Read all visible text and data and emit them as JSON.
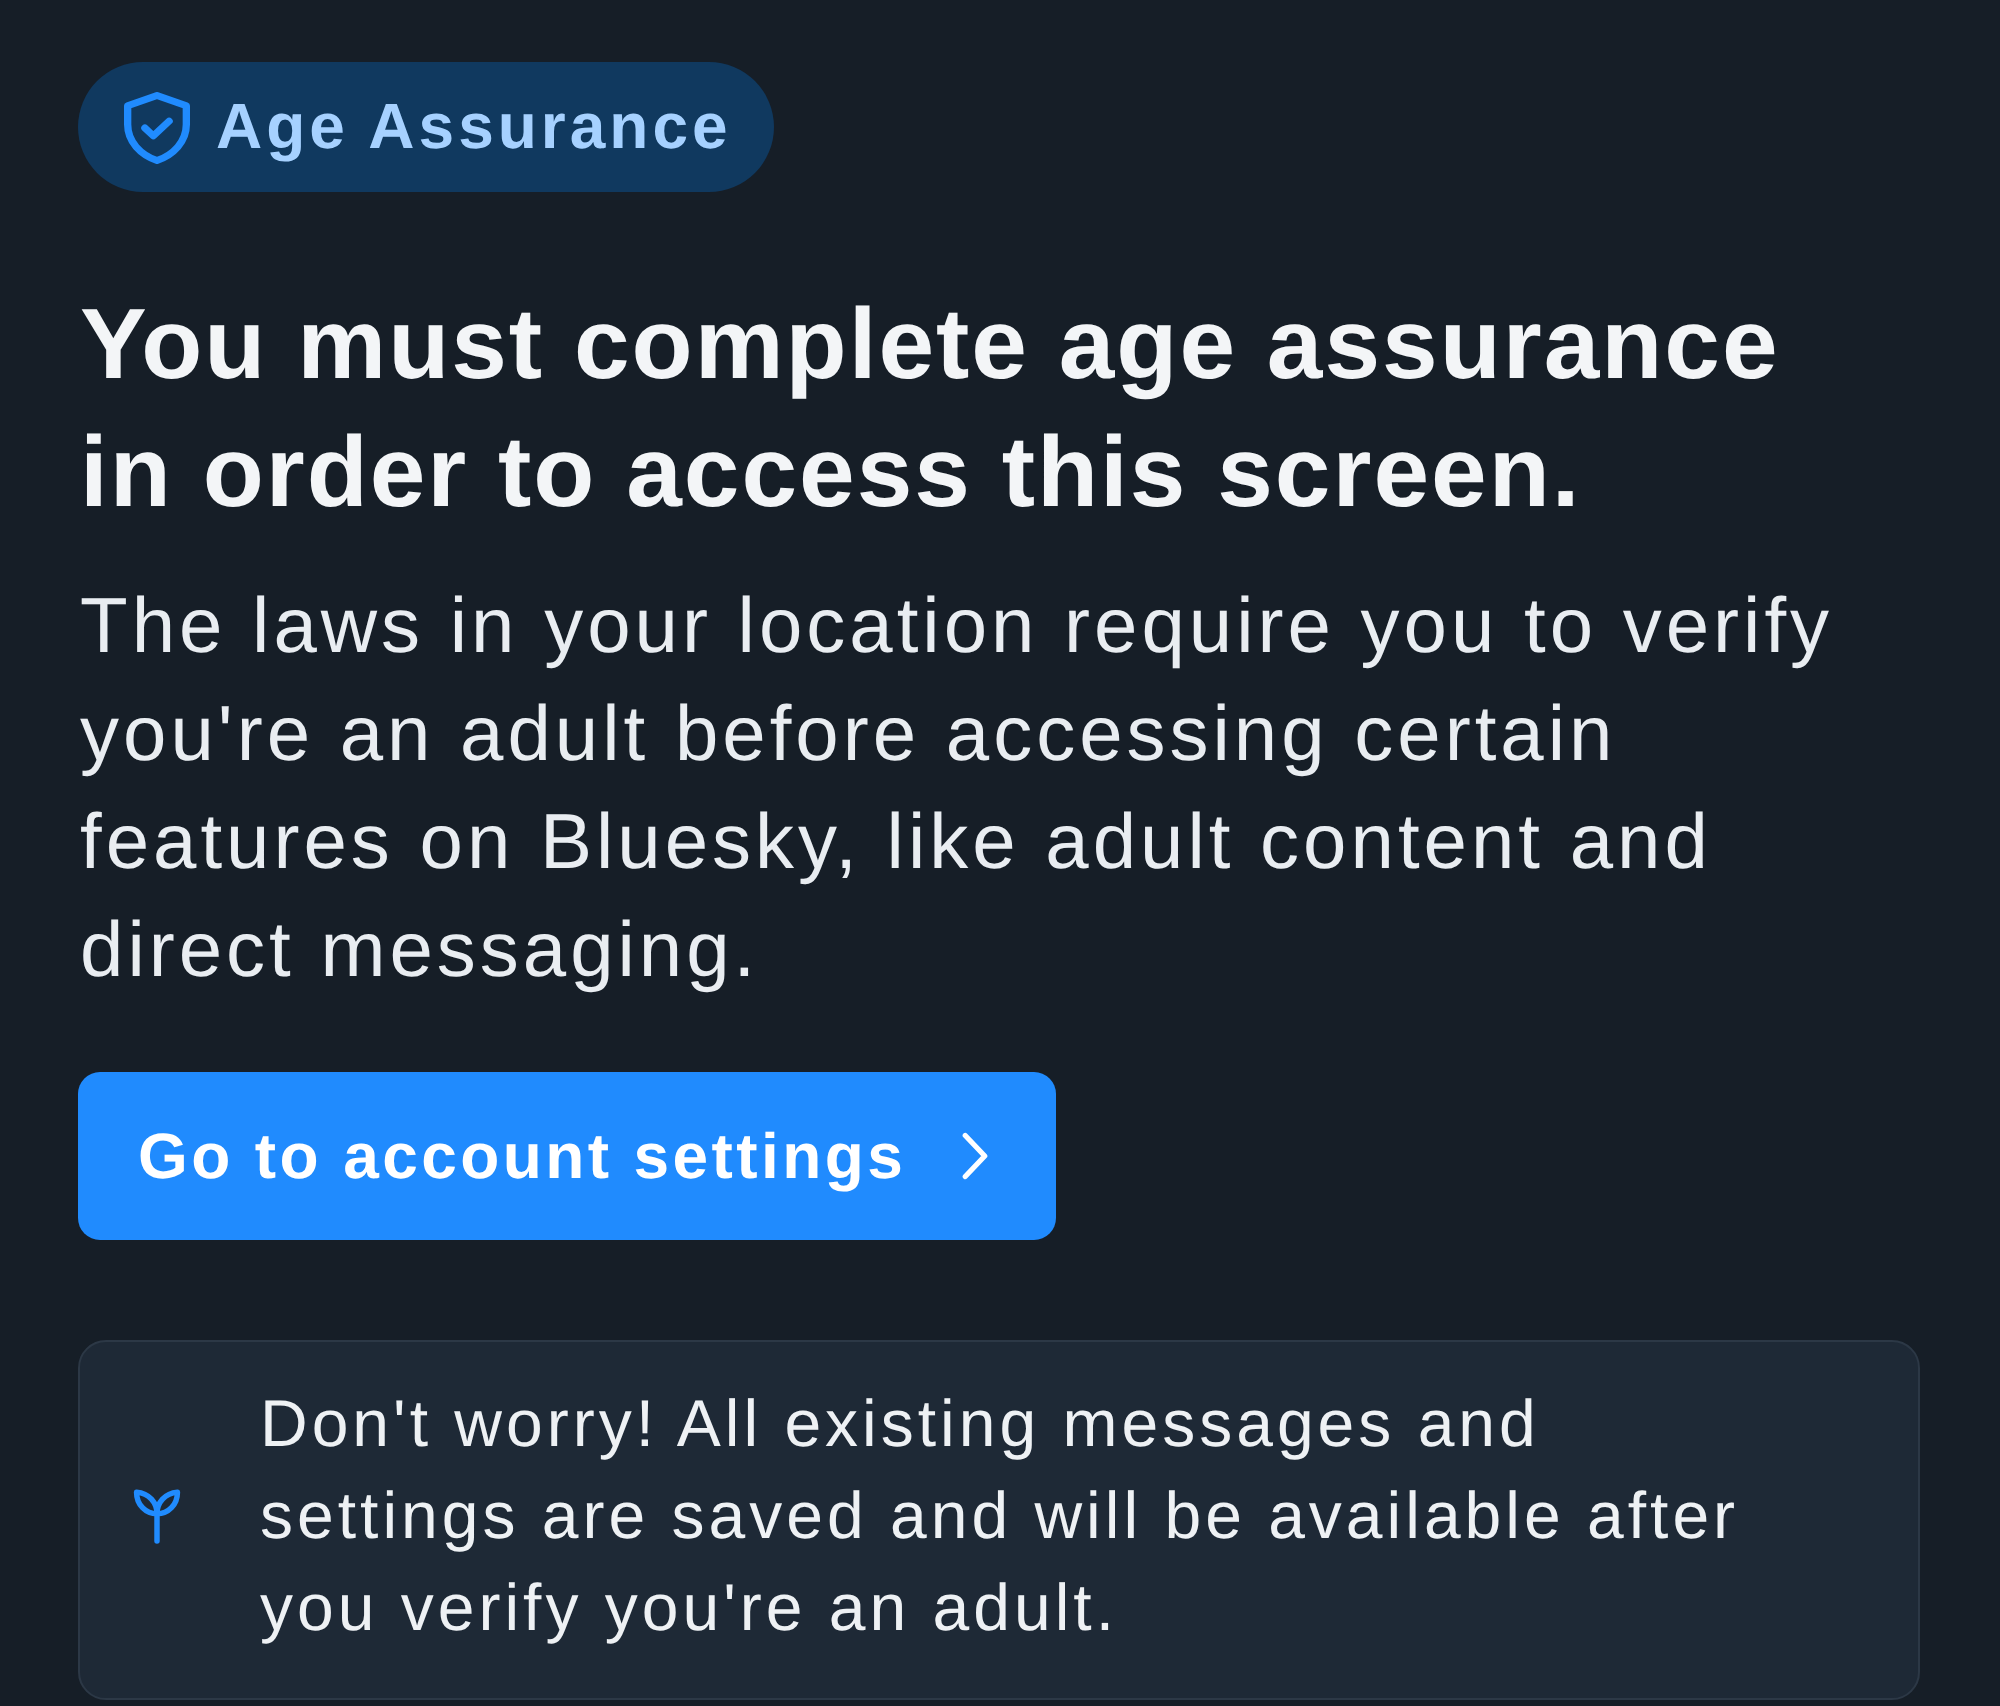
{
  "badge": {
    "label": "Age Assurance"
  },
  "heading": "You must complete age assurance in order to access this screen.",
  "description": "The laws in your location require you to verify you're an adult before accessing certain features on Bluesky, like adult content and direct messaging.",
  "button": {
    "label": "Go to account settings"
  },
  "notice": {
    "text": "Don't worry! All existing messages and settings are saved and will be available after you verify you're an adult."
  }
}
